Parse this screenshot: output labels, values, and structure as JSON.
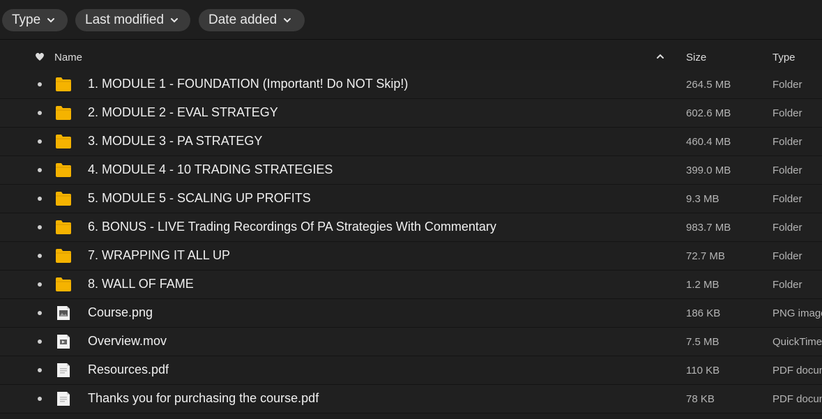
{
  "filters": {
    "type_label": "Type",
    "last_modified_label": "Last modified",
    "date_added_label": "Date added"
  },
  "columns": {
    "name": "Name",
    "size": "Size",
    "type": "Type"
  },
  "colors": {
    "folder": "#f5b300",
    "background": "#1e1e1e",
    "chip": "#3a3a3a"
  },
  "files": [
    {
      "name": "1. MODULE 1 - FOUNDATION (Important! Do NOT Skip!)",
      "size": "264.5 MB",
      "type": "Folder",
      "icon": "folder-icon"
    },
    {
      "name": "2. MODULE 2 - EVAL STRATEGY",
      "size": "602.6 MB",
      "type": "Folder",
      "icon": "folder-icon"
    },
    {
      "name": "3. MODULE 3 - PA STRATEGY",
      "size": "460.4 MB",
      "type": "Folder",
      "icon": "folder-icon"
    },
    {
      "name": "4. MODULE 4 - 10 TRADING STRATEGIES",
      "size": "399.0 MB",
      "type": "Folder",
      "icon": "folder-icon"
    },
    {
      "name": "5. MODULE 5 - SCALING UP PROFITS",
      "size": "9.3 MB",
      "type": "Folder",
      "icon": "folder-icon"
    },
    {
      "name": "6. BONUS - LIVE Trading Recordings Of PA Strategies With Commentary",
      "size": "983.7 MB",
      "type": "Folder",
      "icon": "folder-icon"
    },
    {
      "name": "7. WRAPPING IT ALL UP",
      "size": "72.7 MB",
      "type": "Folder",
      "icon": "folder-icon"
    },
    {
      "name": "8. WALL OF FAME",
      "size": "1.2 MB",
      "type": "Folder",
      "icon": "folder-icon"
    },
    {
      "name": "Course.png",
      "size": "186 KB",
      "type": "PNG image",
      "icon": "image-file-icon"
    },
    {
      "name": "Overview.mov",
      "size": "7.5 MB",
      "type": "QuickTime movie",
      "icon": "video-file-icon"
    },
    {
      "name": "Resources.pdf",
      "size": "110 KB",
      "type": "PDF document",
      "icon": "pdf-file-icon"
    },
    {
      "name": "Thanks you for purchasing the course.pdf",
      "size": "78 KB",
      "type": "PDF document",
      "icon": "pdf-file-icon"
    }
  ]
}
